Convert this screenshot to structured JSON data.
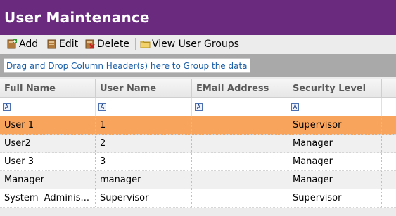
{
  "title": "User Maintenance",
  "toolbar": {
    "add_label": "Add",
    "edit_label": "Edit",
    "delete_label": "Delete",
    "view_groups_label": "View User Groups"
  },
  "group_hint": "Drag and Drop Column Header(s) here to Group the data",
  "columns": [
    "Full Name",
    "User Name",
    "EMail Address",
    "Security Level"
  ],
  "rows": [
    {
      "full_name": "User 1",
      "user_name": "1",
      "email": "",
      "security": "Supervisor",
      "selected": true
    },
    {
      "full_name": "User2",
      "user_name": "2",
      "email": "",
      "security": "Manager"
    },
    {
      "full_name": "User 3",
      "user_name": "3",
      "email": "",
      "security": "Manager"
    },
    {
      "full_name": "Manager",
      "user_name": "manager",
      "email": "",
      "security": "Manager"
    },
    {
      "full_name": "System  Adminis...",
      "user_name": "Supervisor",
      "email": "",
      "security": "Supervisor"
    }
  ],
  "colors": {
    "title_bar": "#6a2a7e",
    "selected_row": "#f9a45c",
    "group_area": "#a9a9a9",
    "hint_text": "#1a5ea8"
  },
  "icons": {
    "add": "add-icon",
    "edit": "edit-icon",
    "delete": "delete-icon",
    "view_groups": "folder-icon",
    "filter": "filter-icon"
  }
}
